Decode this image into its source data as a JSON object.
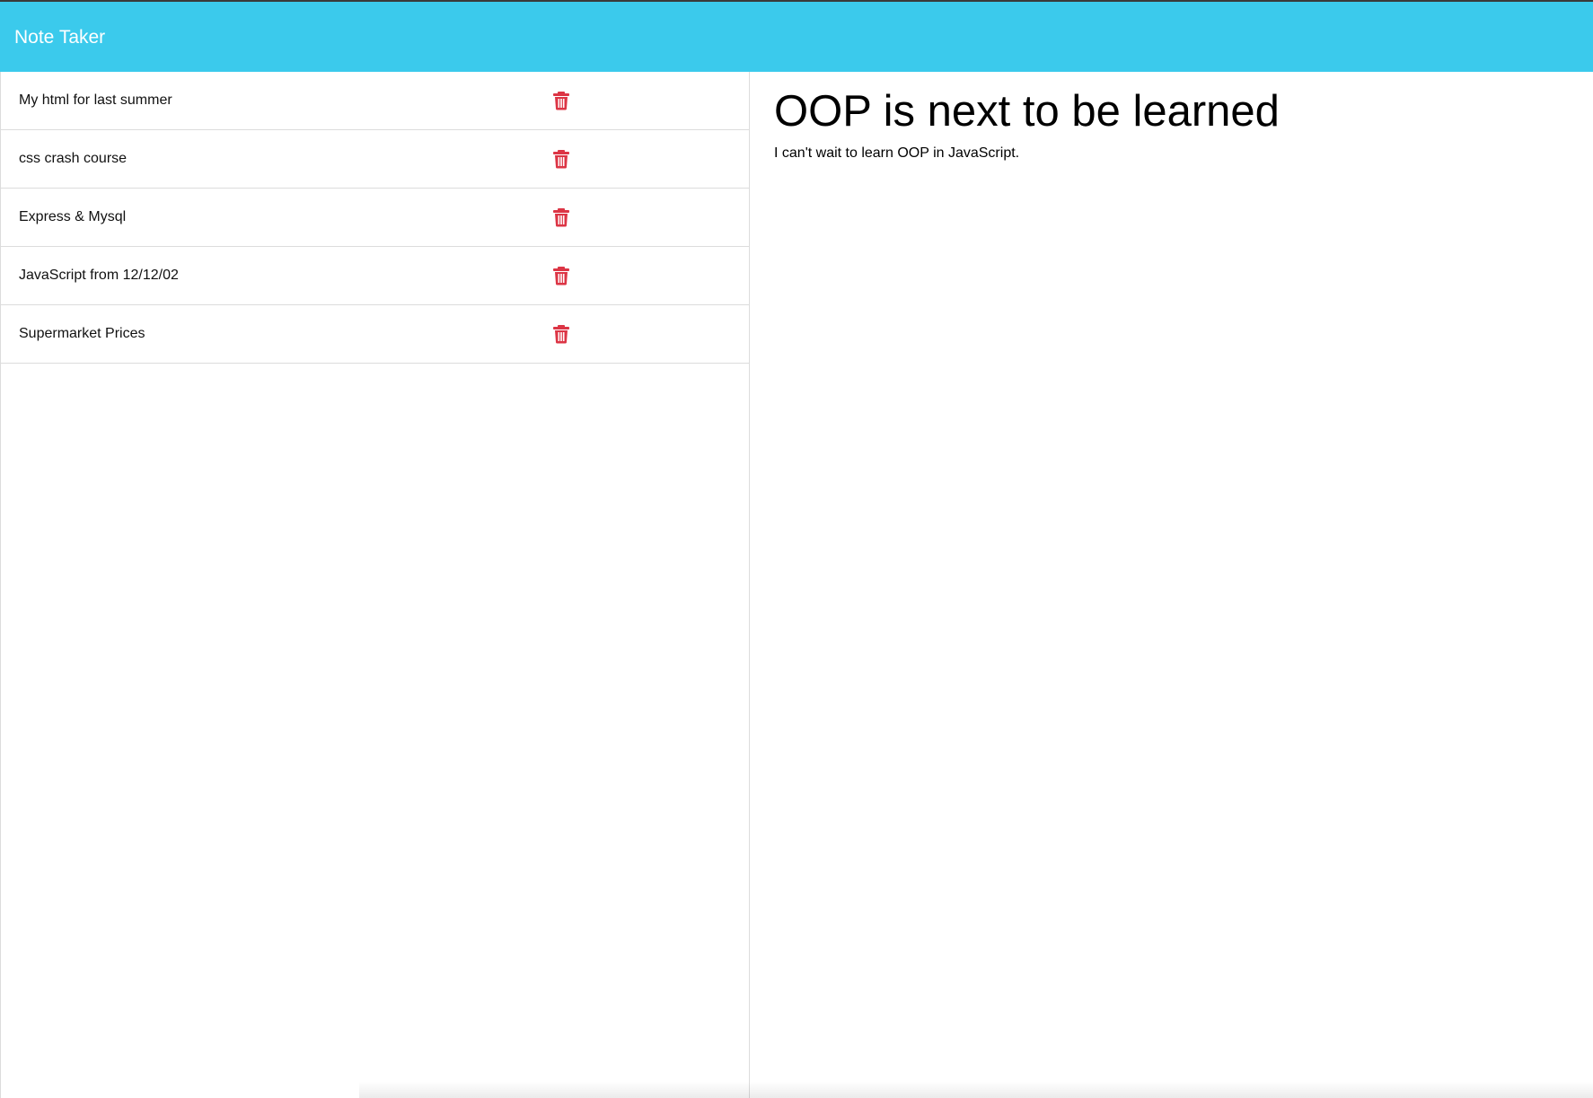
{
  "app": {
    "brand": "Note Taker"
  },
  "notes": [
    {
      "title": "My html for last summer"
    },
    {
      "title": "css crash course"
    },
    {
      "title": "Express & Mysql"
    },
    {
      "title": "JavaScript from 12/12/02"
    },
    {
      "title": "Supermarket Prices"
    }
  ],
  "active_note": {
    "title": "OOP is next to be learned",
    "text": "I can't wait to learn OOP in JavaScript."
  },
  "icons": {
    "delete": "trash-icon"
  },
  "colors": {
    "navbar": "#3bcaec",
    "delete_icon": "#dc3545"
  }
}
